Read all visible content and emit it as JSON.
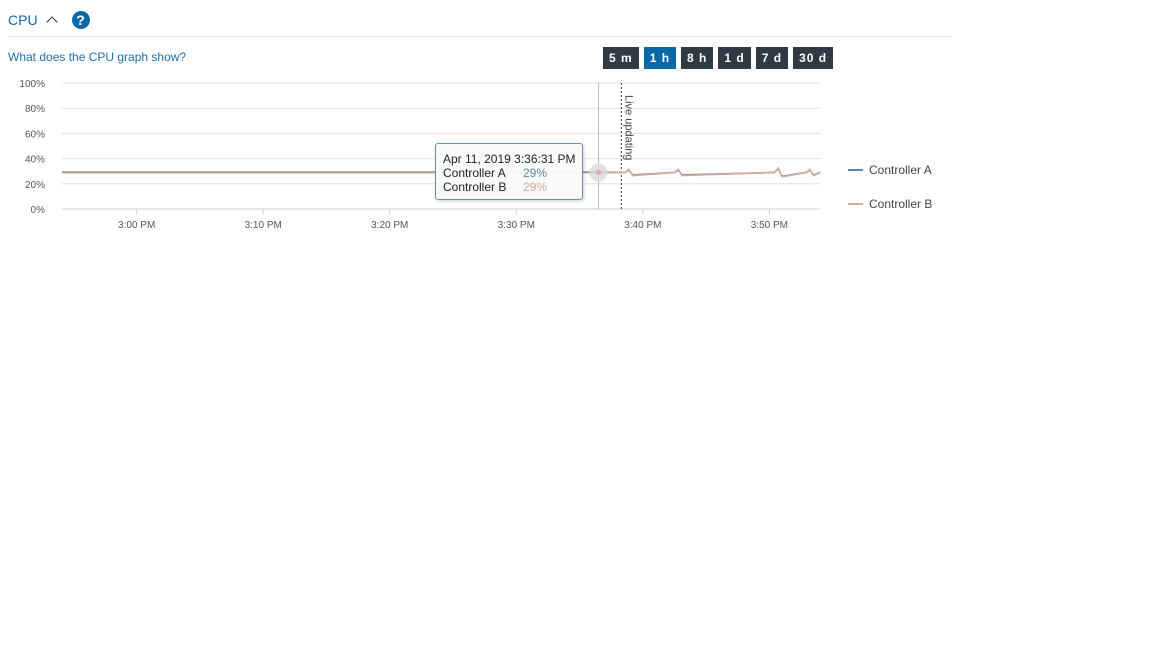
{
  "header": {
    "title": "CPU",
    "help_icon": "question-circle-icon",
    "collapse_icon": "chevron-up-icon"
  },
  "help_link": "What does the CPU graph show?",
  "ranges": [
    {
      "label": "5 m",
      "active": false
    },
    {
      "label": "1 h",
      "active": true
    },
    {
      "label": "8 h",
      "active": false
    },
    {
      "label": "1 d",
      "active": false
    },
    {
      "label": "7 d",
      "active": false
    },
    {
      "label": "30 d",
      "active": false
    }
  ],
  "tooltip": {
    "time": "Apr 11, 2019 3:36:31 PM",
    "rows": [
      {
        "name": "Controller A",
        "value": "29%"
      },
      {
        "name": "Controller B",
        "value": "29%"
      }
    ]
  },
  "legend": [
    {
      "name": "Controller A",
      "color": "#5b87b0"
    },
    {
      "name": "Controller B",
      "color": "#d8a898"
    }
  ],
  "chart_data": {
    "type": "line",
    "x_unit": "minutes after 3:00 PM",
    "xlim": [
      -5.9,
      54
    ],
    "ylim": [
      0,
      100
    ],
    "yticks": [
      "0%",
      "20%",
      "40%",
      "60%",
      "80%",
      "100%"
    ],
    "xticks": [
      {
        "x": 0,
        "label": "3:00 PM"
      },
      {
        "x": 10,
        "label": "3:10 PM"
      },
      {
        "x": 20,
        "label": "3:20 PM"
      },
      {
        "x": 30,
        "label": "3:30 PM"
      },
      {
        "x": 40,
        "label": "3:40 PM"
      },
      {
        "x": 50,
        "label": "3:50 PM"
      }
    ],
    "hover_x": 36.5,
    "live_x": 38.3,
    "live_label": "Live updating",
    "series": [
      {
        "name": "Controller A",
        "color": "#5b87b0",
        "x": [
          -5.9,
          36.5,
          38.6,
          38.9,
          39.2,
          42.5,
          42.8,
          43.1,
          50.4,
          50.7,
          51.0,
          52.9,
          53.2,
          53.5,
          54
        ],
        "y": [
          29,
          29,
          29,
          31,
          27,
          29,
          31,
          27,
          29,
          32,
          26,
          29,
          31,
          27,
          29
        ]
      },
      {
        "name": "Controller B",
        "color": "#d8a898",
        "x": [
          -5.9,
          36.5,
          38.6,
          38.9,
          39.2,
          42.5,
          42.8,
          43.1,
          50.4,
          50.7,
          51.0,
          52.9,
          53.2,
          53.5,
          54
        ],
        "y": [
          29.5,
          29.5,
          29,
          31.5,
          26.5,
          29,
          31.5,
          26.5,
          29,
          32.5,
          25.5,
          29,
          31.5,
          26.5,
          29.5
        ]
      }
    ]
  }
}
